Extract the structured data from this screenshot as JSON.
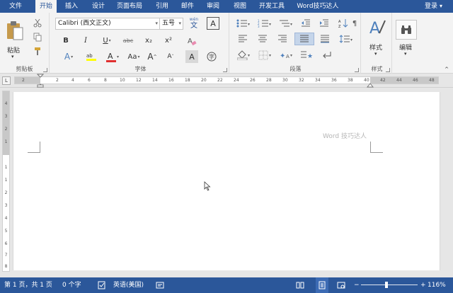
{
  "tabs": {
    "file": "文件",
    "items": [
      "开始",
      "插入",
      "设计",
      "页面布局",
      "引用",
      "邮件",
      "审阅",
      "视图",
      "开发工具",
      "Word技巧达人"
    ],
    "login": "登录"
  },
  "ribbon": {
    "clipboard": {
      "label": "剪贴板",
      "paste": "粘贴"
    },
    "font": {
      "label": "字体",
      "font_name": "Calibri (西文正文)",
      "font_size": "五号",
      "bold": "B",
      "italic": "I",
      "underline": "U",
      "strike": "abc",
      "sub": "x₂",
      "sup": "x²",
      "font_a": "A",
      "case": "Aa",
      "wen": "文"
    },
    "paragraph": {
      "label": "段落"
    },
    "styles": {
      "label": "样式",
      "button": "样式"
    },
    "editing": {
      "button": "编辑"
    }
  },
  "ruler": {
    "corner": "L",
    "ticks": [
      "2",
      "2",
      "4",
      "6",
      "8",
      "10",
      "12",
      "14",
      "16",
      "18",
      "20",
      "22",
      "24",
      "26",
      "28",
      "30",
      "32",
      "34",
      "36",
      "38",
      "40",
      "42",
      "44",
      "46",
      "48"
    ],
    "vticks": [
      "4",
      "3",
      "2",
      "1",
      "1",
      "1",
      "2",
      "3",
      "4",
      "5",
      "6",
      "7",
      "8",
      "9",
      "10"
    ]
  },
  "document": {
    "watermark": "Word 技巧达人"
  },
  "status": {
    "page": "第 1 页，共 1 页",
    "words": "0 个字",
    "language": "英语(美国)",
    "zoom": "116%"
  },
  "colors": {
    "brand": "#2b579a",
    "ribbon_bg": "#f3f3f3",
    "highlight": "#ffff00",
    "font_color": "#e03030"
  }
}
